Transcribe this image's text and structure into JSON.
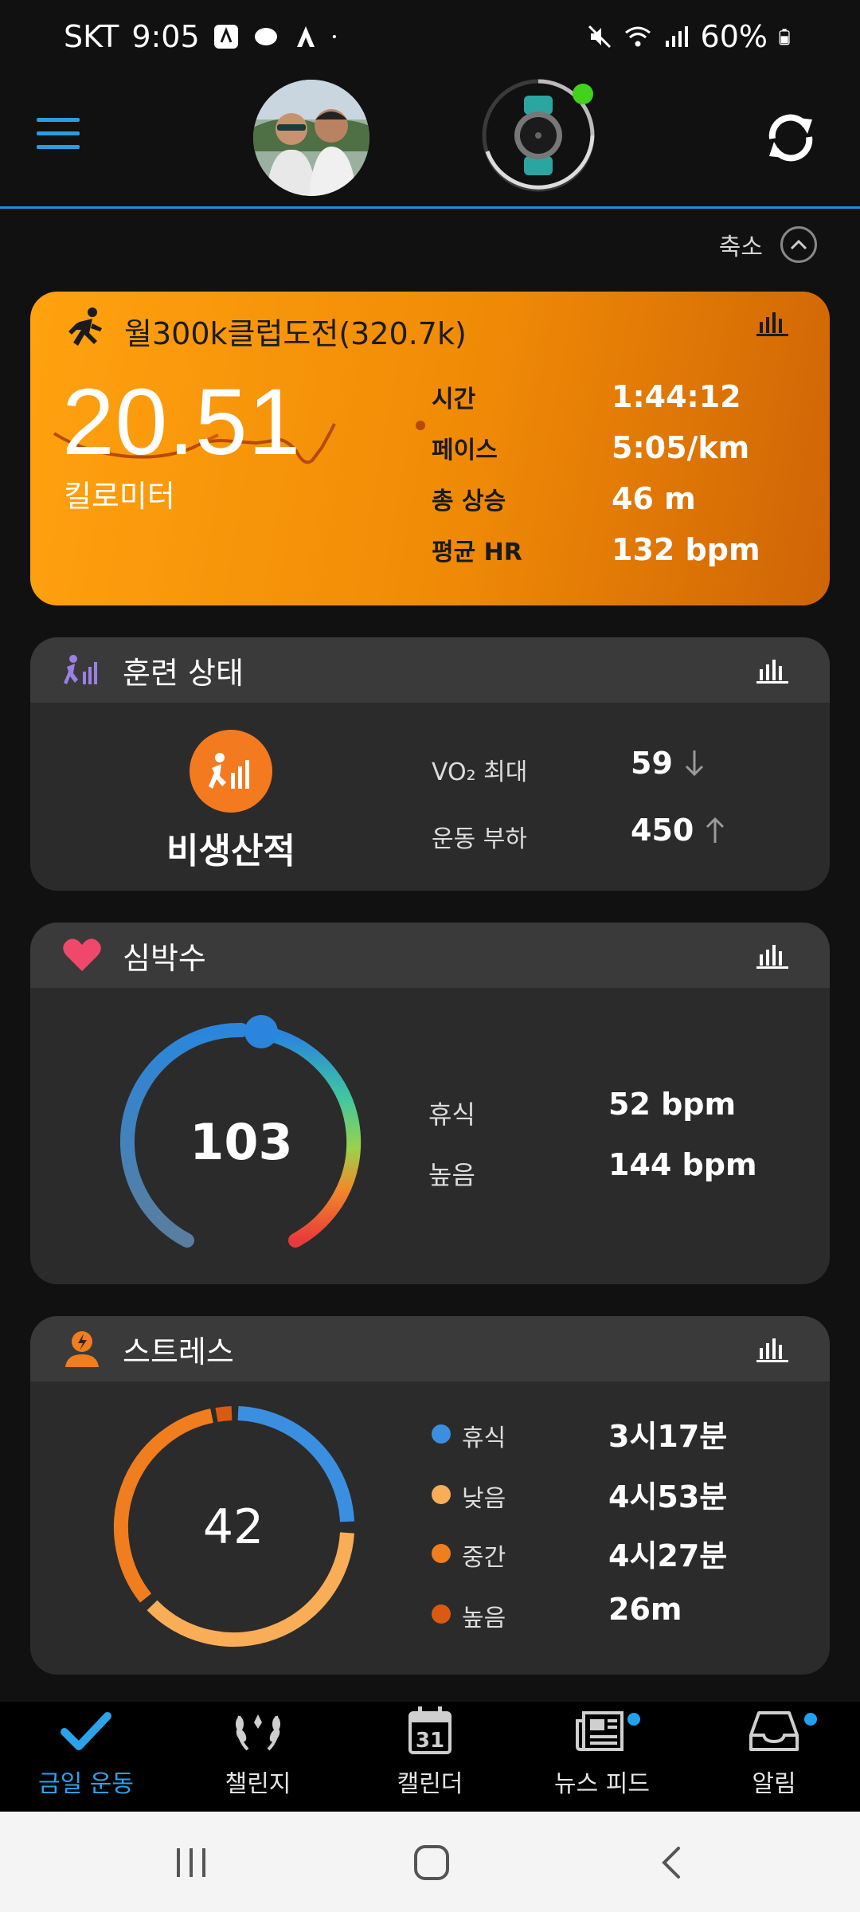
{
  "status_bar": {
    "carrier": "SKT",
    "time": "9:05",
    "battery": "60%"
  },
  "header": {
    "menu_icon": "hamburger-icon",
    "sync_icon": "sync-icon",
    "device_status_color": "#42d21b"
  },
  "collapse": {
    "label": "축소"
  },
  "activity": {
    "title": "월300k클럽도전(320.7k)",
    "distance": "20.51",
    "distance_unit": "킬로미터",
    "stats": [
      {
        "label": "시간",
        "value": "1:44:12"
      },
      {
        "label": "페이스",
        "value": "5:05/km"
      },
      {
        "label": "총 상승",
        "value": "46 m"
      },
      {
        "label": "평균 HR",
        "value": "132 bpm"
      }
    ],
    "accent": "#f08a06"
  },
  "training_status": {
    "title": "훈련 상태",
    "status": "비생산적",
    "vo2_label": "VO₂ 최대",
    "vo2_value": "59",
    "vo2_trend": "down",
    "load_label": "운동 부하",
    "load_value": "450",
    "load_trend": "up"
  },
  "heart_rate": {
    "title": "심박수",
    "current": "103",
    "resting_label": "휴식",
    "resting_value": "52 bpm",
    "high_label": "높음",
    "high_value": "144 bpm"
  },
  "stress": {
    "title": "스트레스",
    "level": "42",
    "legend": [
      {
        "label": "휴식",
        "value": "3시17분",
        "color": "#3b8fe0"
      },
      {
        "label": "낮음",
        "value": "4시53분",
        "color": "#f9ad57"
      },
      {
        "label": "중간",
        "value": "4시27분",
        "color": "#f07d1e"
      },
      {
        "label": "높음",
        "value": "26m",
        "color": "#d95a10"
      }
    ]
  },
  "bottom_nav": {
    "items": [
      {
        "label": "금일 운동",
        "active": true
      },
      {
        "label": "챌린지"
      },
      {
        "label": "캘린더",
        "calendar_day": "31"
      },
      {
        "label": "뉴스 피드",
        "badge": true
      },
      {
        "label": "알림",
        "badge": true
      }
    ]
  }
}
